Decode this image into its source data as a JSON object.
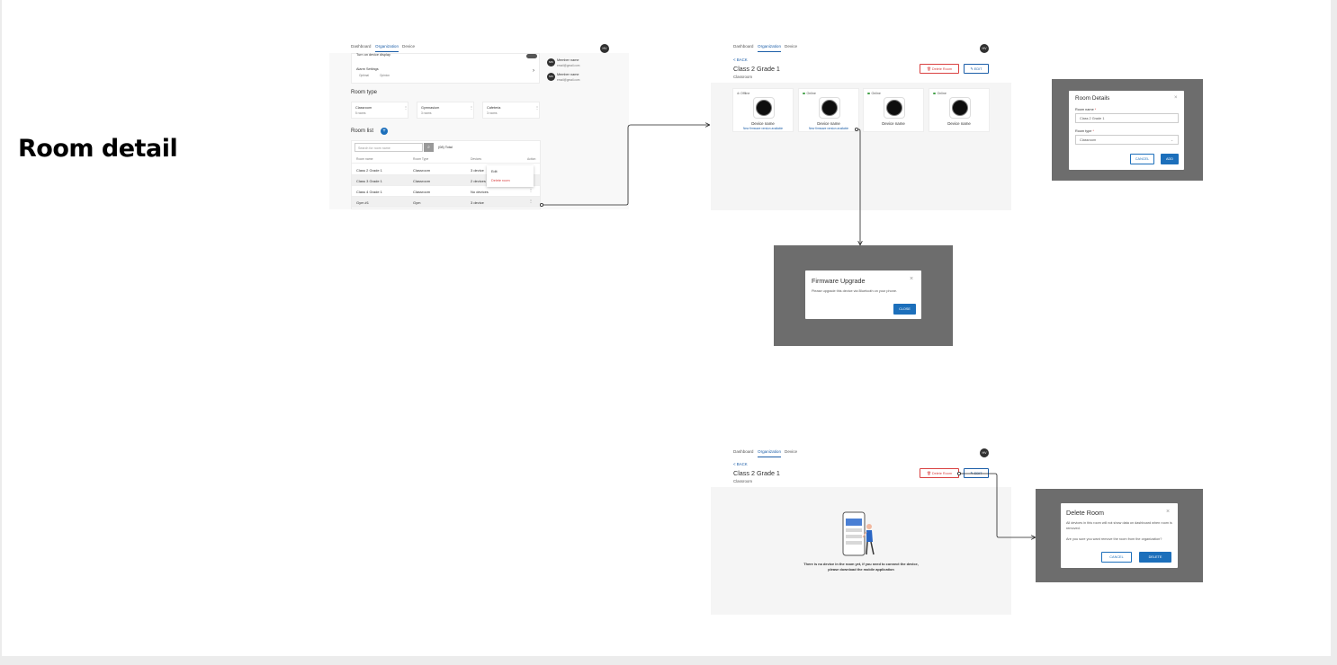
{
  "heading": "Room detail",
  "nav": {
    "dashboard": "Dashboard",
    "organization": "Organization",
    "device": "Device",
    "avatar": "HV"
  },
  "org_screen": {
    "toggle_label": "Turn on device display",
    "alarm": {
      "title": "Alarm Settings",
      "info1": "Optimal",
      "info2": "Opinion"
    },
    "members": [
      {
        "avatar": "MN",
        "name": "Member name",
        "email": "email@gmail.com"
      },
      {
        "avatar": "MN",
        "name": "Member name",
        "email": "email@gmail.com"
      }
    ],
    "room_type_title": "Room type",
    "room_types": [
      {
        "name": "Classroom",
        "count": "5 rooms"
      },
      {
        "name": "Gymnasium",
        "count": "3 rooms"
      },
      {
        "name": "Cafeteria",
        "count": "3 rooms"
      }
    ],
    "room_list_title": "Room list",
    "add_icon": "+",
    "search_placeholder": "Search for room name",
    "total": "(08) Total",
    "columns": [
      "Room name",
      "Room Type",
      "Devices",
      "Action"
    ],
    "rows": [
      {
        "name": "Class 2 Grade 1",
        "type": "Classroom",
        "devices": "3 device"
      },
      {
        "name": "Class 3 Grade 1",
        "type": "Classroom",
        "devices": "2 devices"
      },
      {
        "name": "Class 4 Grade 1",
        "type": "Classroom",
        "devices": "No devices"
      },
      {
        "name": "Gym #1",
        "type": "Gym",
        "devices": "3 device"
      }
    ],
    "menu": {
      "edit": "Edit",
      "delete": "Delete room"
    }
  },
  "room_screen": {
    "back": "< BACK",
    "title": "Class 2 Grade 1",
    "subtitle": "Classroom",
    "delete_btn": "Delete Room",
    "edit_btn": "EDIT",
    "devices": [
      {
        "status": "Offline",
        "name": "Device name",
        "link": "New firmware version available"
      },
      {
        "status": "Online",
        "name": "Device name",
        "link": "New firmware version available"
      },
      {
        "status": "Online",
        "name": "Device name",
        "link": ""
      },
      {
        "status": "Online",
        "name": "Device name",
        "link": ""
      }
    ]
  },
  "room_details_modal": {
    "title": "Room Details",
    "name_label": "Room name",
    "name_value": "Class 2 Grade 1",
    "type_label": "Room type",
    "type_value": "Classroom",
    "required": "*",
    "cancel": "CANCEL",
    "add": "ADD"
  },
  "firmware_modal": {
    "title": "Firmware Upgrade",
    "text": "Please upgrade this device via Bluetooth on your phone.",
    "close": "CLOSE"
  },
  "empty_screen": {
    "back": "< BACK",
    "title": "Class 2 Grade 1",
    "subtitle": "Classroom",
    "delete_btn": "Delete Room",
    "edit_btn": "EDIT",
    "empty_line1": "There is no device in the room yet, if you need to connect the device,",
    "empty_line2": "please download the mobile application"
  },
  "delete_modal": {
    "title": "Delete Room",
    "text1": "All devices in this room will not show data on dashboard when room is removed.",
    "text2": "Are you sure you want remove the room from the organization?",
    "cancel": "CANCEL",
    "delete": "DELETE"
  },
  "colors": {
    "primary": "#1c6fbb",
    "danger": "#d94141",
    "overlay": "#6d6d6d"
  }
}
